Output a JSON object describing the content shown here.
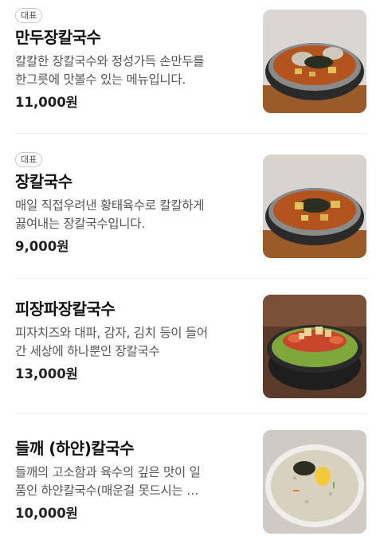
{
  "menu": {
    "items": [
      {
        "badge": "대표",
        "name": "만두장칼국수",
        "description_line1": "칼칼한 장칼국수와 정성가득 손만두를",
        "description_line2": "한그릇에 맛볼수 있는 메뉴입니다.",
        "price": "11,000원",
        "image": "dumpling-jang-kalguksu-photo"
      },
      {
        "badge": "대표",
        "name": "장칼국수",
        "description_line1": "매일 직접우려낸 황태육수로 칼칼하게",
        "description_line2": "끓여내는 장칼국수입니다.",
        "price": "9,000원",
        "image": "jang-kalguksu-photo"
      },
      {
        "badge": "",
        "name": "피장파장칼국수",
        "description_line1": "피자치즈와 대파, 감자, 김치 등이 들어",
        "description_line2": "간 세상에 하나뿐인 장칼국수",
        "price": "13,000원",
        "image": "pizza-cheese-kalguksu-photo"
      },
      {
        "badge": "",
        "name": "들깨 (하얀)칼국수",
        "description_line1": "들깨의 고소함과 육수의 깊은 맛이 일",
        "description_line2": "품인 하얀칼국수(매운걸 못드시는 …",
        "price": "10,000원",
        "image": "perilla-white-kalguksu-photo"
      }
    ]
  },
  "colors": {
    "text_primary": "#111111",
    "text_secondary": "#555555",
    "badge_border": "#c9c9c9",
    "divider": "#efefef"
  }
}
